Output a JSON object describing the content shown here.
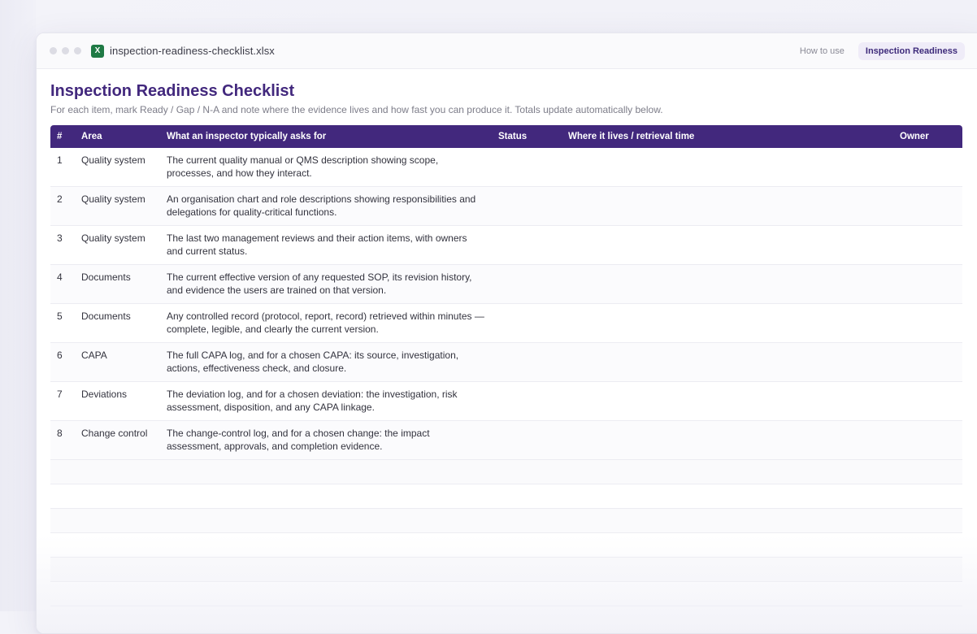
{
  "window": {
    "filename": "inspection-readiness-checklist.xlsx",
    "file_icon_letter": "X",
    "tabs": [
      {
        "label": "How to use",
        "active": false
      },
      {
        "label": "Inspection Readiness",
        "active": true
      }
    ]
  },
  "sheet": {
    "title": "Inspection Readiness Checklist",
    "subtitle": "For each item, mark Ready / Gap / N-A and note where the evidence lives and how fast you can produce it. Totals update automatically below.",
    "columns": [
      "#",
      "Area",
      "What an inspector typically asks for",
      "Status",
      "Where it lives / retrieval time",
      "Owner"
    ],
    "rows": [
      {
        "num": "1",
        "area": "Quality system",
        "ask": "The current quality manual or QMS description showing scope, processes, and how they interact.",
        "status": "",
        "where": "",
        "owner": ""
      },
      {
        "num": "2",
        "area": "Quality system",
        "ask": "An organisation chart and role descriptions showing responsibilities and delegations for quality-critical functions.",
        "status": "",
        "where": "",
        "owner": ""
      },
      {
        "num": "3",
        "area": "Quality system",
        "ask": "The last two management reviews and their action items, with owners and current status.",
        "status": "",
        "where": "",
        "owner": ""
      },
      {
        "num": "4",
        "area": "Documents",
        "ask": "The current effective version of any requested SOP, its revision history, and evidence the users are trained on that version.",
        "status": "",
        "where": "",
        "owner": ""
      },
      {
        "num": "5",
        "area": "Documents",
        "ask": "Any controlled record (protocol, report, record) retrieved within minutes — complete, legible, and clearly the current version.",
        "status": "",
        "where": "",
        "owner": ""
      },
      {
        "num": "6",
        "area": "CAPA",
        "ask": "The full CAPA log, and for a chosen CAPA: its source, investigation, actions, effectiveness check, and closure.",
        "status": "",
        "where": "",
        "owner": ""
      },
      {
        "num": "7",
        "area": "Deviations",
        "ask": "The deviation log, and for a chosen deviation: the investigation, risk assessment, disposition, and any CAPA linkage.",
        "status": "",
        "where": "",
        "owner": ""
      },
      {
        "num": "8",
        "area": "Change control",
        "ask": "The change-control log, and for a chosen change: the impact assessment, approvals, and completion evidence.",
        "status": "",
        "where": "",
        "owner": ""
      }
    ],
    "empty_rows": 6
  },
  "colors": {
    "accent": "#42287d",
    "excel_green": "#1f7a45",
    "active_tab_bg": "#efecf8"
  }
}
